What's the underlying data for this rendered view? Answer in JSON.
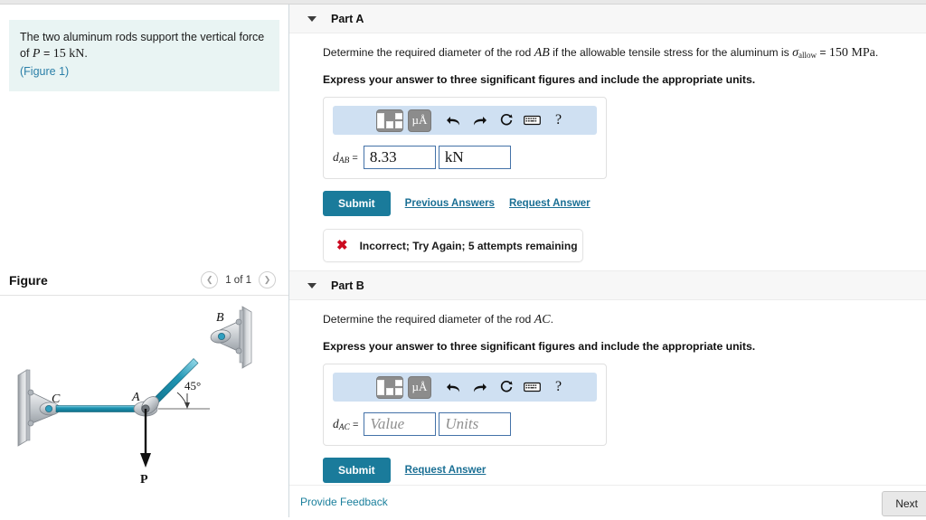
{
  "problem": {
    "text_before": "The two aluminum rods support the vertical force of ",
    "force_symbol": "P",
    "equals": " = ",
    "force_value": "15 kN",
    "period": ".",
    "figure_link": "(Figure 1)"
  },
  "figure_panel": {
    "title": "Figure",
    "counter": "1 of 1",
    "prev_icon": "chevron-left-icon",
    "next_icon": "chevron-right-icon",
    "diagram": {
      "label_A": "A",
      "label_B": "B",
      "label_C": "C",
      "label_P": "P",
      "angle": "45°",
      "rod_color": "#2196b4",
      "support_color": "#b9bec4"
    }
  },
  "toolbar": {
    "template_icon": "math-template-icon",
    "units_label": "µÅ",
    "undo_icon": "undo-arrow-icon",
    "redo_icon": "redo-arrow-icon",
    "reset_icon": "reset-circle-icon",
    "keyboard_icon": "keyboard-icon",
    "help_label": "?"
  },
  "parts": [
    {
      "header": "Part A",
      "question_before": "Determine the required diameter of the rod ",
      "question_rod": "AB",
      "question_middle": " if the allowable tensile stress for the aluminum is ",
      "sigma_symbol": "σ",
      "sigma_sub": "allow",
      "sigma_equals": " = ",
      "sigma_value": "150 MPa",
      "question_end": ".",
      "instruction": "Express your answer to three significant figures and include the appropriate units.",
      "var_name": "d",
      "var_sub": "AB",
      "var_eq": " = ",
      "value": "8.33",
      "units": "kN",
      "value_placeholder": "Value",
      "units_placeholder": "Units",
      "submit_label": "Submit",
      "previous_answers_label": "Previous Answers",
      "request_answer_label": "Request Answer",
      "feedback": "Incorrect; Try Again; 5 attempts remaining",
      "feedback_icon": "error-x-icon"
    },
    {
      "header": "Part B",
      "question_before": "Determine the required diameter of the rod ",
      "question_rod": "AC",
      "question_end": ".",
      "instruction": "Express your answer to three significant figures and include the appropriate units.",
      "var_name": "d",
      "var_sub": "AC",
      "var_eq": " = ",
      "value": "",
      "units": "",
      "value_placeholder": "Value",
      "units_placeholder": "Units",
      "submit_label": "Submit",
      "request_answer_label": "Request Answer"
    }
  ],
  "footer": {
    "provide_feedback": "Provide Feedback",
    "next_label": "Next"
  },
  "colors": {
    "accent": "#1a7b9b",
    "link": "#1a6f94",
    "prompt_bg": "#e9f4f3",
    "toolbar_bg": "#cfe0f2",
    "error": "#cc0a20"
  }
}
